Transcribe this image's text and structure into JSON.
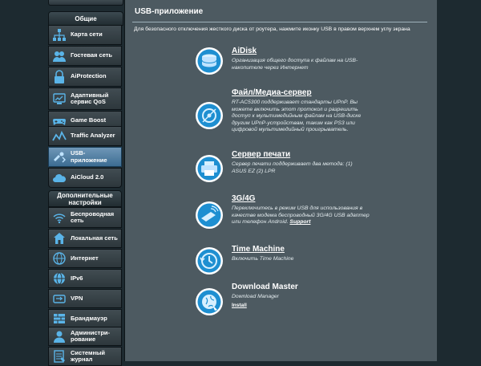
{
  "sidebar": {
    "top_cut_label": "...",
    "general_header": "Общие",
    "general_items": [
      {
        "icon": "network-map-icon",
        "label": "Карта сети"
      },
      {
        "icon": "guest-network-icon",
        "label": "Гостевая сеть"
      },
      {
        "icon": "aiprotection-lock-icon",
        "label": "AiProtection"
      },
      {
        "icon": "adaptive-qos-icon",
        "label": "Адаптивный сервис QoS"
      },
      {
        "icon": "game-boost-icon",
        "label": "Game Boost"
      },
      {
        "icon": "traffic-analyzer-icon",
        "label": "Traffic Analyzer"
      },
      {
        "icon": "usb-app-icon",
        "label": "USB-приложение"
      },
      {
        "icon": "aicloud-icon",
        "label": "AiCloud 2.0"
      }
    ],
    "advanced_header": "Дополнительные настройки",
    "advanced_items": [
      {
        "icon": "wireless-icon",
        "label": "Беспроводная сеть"
      },
      {
        "icon": "lan-home-icon",
        "label": "Локальная сеть"
      },
      {
        "icon": "internet-globe-icon",
        "label": "Интернет"
      },
      {
        "icon": "ipv6-globe-icon",
        "label": "IPv6"
      },
      {
        "icon": "vpn-icon",
        "label": "VPN"
      },
      {
        "icon": "firewall-icon",
        "label": "Брандмауэр"
      },
      {
        "icon": "admin-user-icon",
        "label": "Администри-рование"
      },
      {
        "icon": "system-log-icon",
        "label": "Системный журнал"
      }
    ]
  },
  "main": {
    "title": "USB-приложение",
    "description": "Для безопасного отключения жесткого диска от роутера, нажмите иконку USB в правом верхнем углу экрана",
    "features": [
      {
        "icon": "aidisk-icon",
        "name": "AiDisk",
        "desc": "Организация общего доступа к файлам на USB-накопителе через Интернет"
      },
      {
        "icon": "media-server-icon",
        "name": "Файл/Медиа-сервер",
        "desc": "RT-AC5300 поддерживает стандарты UPnP. Вы можете включить этот протокол и разрешить доступ к мультимедийным файлам на USB-диске другим UPnP-устройствам, таким как PS3 или цифровой мультимедийный проигрыватель."
      },
      {
        "icon": "printer-icon",
        "name": "Сервер печати",
        "desc": "Сервер печати поддерживает два метода: (1) ASUS EZ (2) LPR"
      },
      {
        "icon": "modem-3g-icon",
        "name": "3G/4G",
        "desc": "Переключитесь в режим USB для использования в качестве модема беспроводный 3G/4G USB адаптер или телефон Android.",
        "link": "Support"
      },
      {
        "icon": "time-machine-icon",
        "name": "Time Machine",
        "desc": "Включить Time Machine"
      },
      {
        "icon": "download-master-icon",
        "name": "Download Master",
        "desc": "Download Manager",
        "link": "Install"
      }
    ]
  },
  "colors": {
    "background": "#1d2a30",
    "panel": "#4d5a61",
    "active_item": "#5b88ad",
    "icon_blue": "#1e8fd1"
  }
}
